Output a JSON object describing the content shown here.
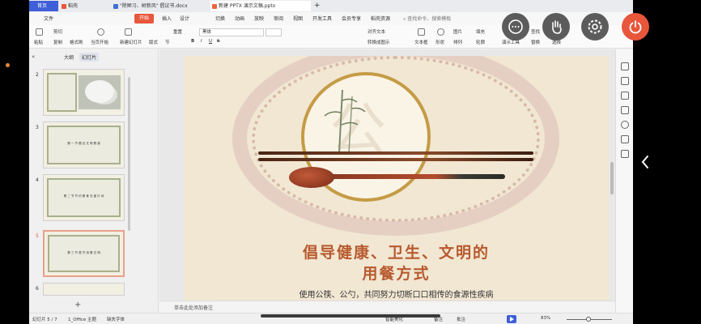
{
  "tabs": [
    {
      "label": "首页",
      "color": "#ffffff"
    },
    {
      "label": "稻壳",
      "color": "#e8563b"
    },
    {
      "label": "\"除陋习、树新风\" 倡议书.docx",
      "color": "#3f6fd8"
    },
    {
      "label": "新建 PPTX 演示文稿.pptx",
      "color": "#e8663b"
    }
  ],
  "tab_add": "+",
  "menu": {
    "file": "文件",
    "start": "开始",
    "items": [
      "插入",
      "设计",
      "切换",
      "动画",
      "放映",
      "审阅",
      "视图",
      "开发工具",
      "会员专享",
      "稻壳资源"
    ],
    "search": "查找命令、搜索模板"
  },
  "ribbon": {
    "paste": "粘贴",
    "cut": "剪切",
    "copy": "复制",
    "format_painter": "格式刷",
    "from_current": "当页开始",
    "new_slide": "新建幻灯片",
    "layout": "版式",
    "section": "节",
    "reset": "重置",
    "font_name": "黑体",
    "text_box": "文本框",
    "shape": "形状",
    "arrange": "排列",
    "picture": "图片",
    "fill": "填充",
    "outline": "轮廓",
    "presentation_tools": "演示工具",
    "find": "查找",
    "replace": "替换",
    "select": "选择",
    "text_direction": "对齐文本",
    "convert_smartart": "转换成图示"
  },
  "panel": {
    "tab_outline": "大纲",
    "tab_slides": "幻灯片",
    "collapse": "«",
    "add": "+",
    "slides": [
      {
        "num": "2",
        "title": "",
        "active": false
      },
      {
        "num": "3",
        "title": "第 一 节  倡 议 文 明 餐 桌",
        "active": false
      },
      {
        "num": "4",
        "title": "第 二 节  节 约 粮 食 光 盘 行 动",
        "active": false
      },
      {
        "num": "5",
        "title": "第 三 节  遵 守 用 餐 文 明",
        "active": true
      },
      {
        "num": "6",
        "title": "",
        "active": false
      }
    ]
  },
  "slide": {
    "medallion_char": "公",
    "title_line1": "倡导健康、卫生、文明的",
    "title_line2": "用餐方式",
    "subtitle": "使用公筷、公勺，共同努力切断口口相传的食源性疾病"
  },
  "notes_placeholder": "单击此处添加备注",
  "status": {
    "slide_counter": "幻灯片 5 / 7",
    "theme": "1_Office 主题",
    "missing_font": "缺失字体",
    "smart_beautify": "智能美化",
    "notes": "备注",
    "comments": "批注",
    "zoom": "83%"
  },
  "overlay": {
    "icons": [
      "chat-icon",
      "hand-icon",
      "settings-icon",
      "power-icon"
    ]
  },
  "colors": {
    "accent_blue": "#3f5fd8",
    "accent_orange": "#e8563b",
    "title_brown": "#b85a2e"
  }
}
